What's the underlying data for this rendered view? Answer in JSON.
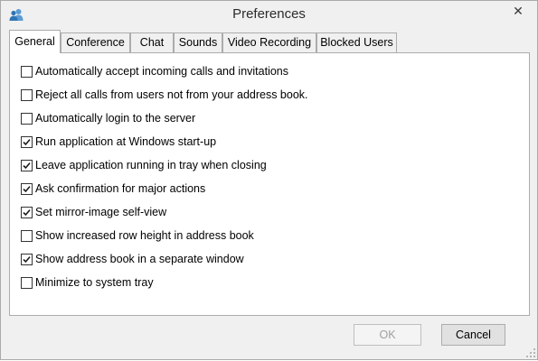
{
  "window": {
    "title": "Preferences",
    "app_icon": "users-icon",
    "close_glyph": "✕"
  },
  "tabs": [
    {
      "label": "General",
      "active": true
    },
    {
      "label": "Conference",
      "active": false
    },
    {
      "label": "Chat",
      "active": false
    },
    {
      "label": "Sounds",
      "active": false
    },
    {
      "label": "Video Recording",
      "active": false
    },
    {
      "label": "Blocked Users",
      "active": false
    }
  ],
  "options": [
    {
      "label": "Automatically accept incoming calls and invitations",
      "checked": false
    },
    {
      "label": "Reject all calls from users not from your address book.",
      "checked": false
    },
    {
      "label": "Automatically login to the server",
      "checked": false
    },
    {
      "label": "Run application at Windows start-up",
      "checked": true
    },
    {
      "label": "Leave application running in tray when closing",
      "checked": true
    },
    {
      "label": "Ask confirmation for major actions",
      "checked": true
    },
    {
      "label": "Set mirror-image self-view",
      "checked": true
    },
    {
      "label": "Show increased row height in address book",
      "checked": false
    },
    {
      "label": "Show address book in a separate window",
      "checked": true
    },
    {
      "label": "Minimize to system tray",
      "checked": false
    }
  ],
  "buttons": {
    "ok": {
      "label": "OK",
      "enabled": false
    },
    "cancel": {
      "label": "Cancel",
      "enabled": true
    }
  }
}
